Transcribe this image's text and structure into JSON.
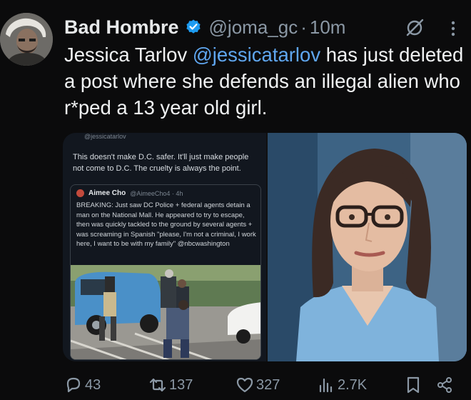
{
  "author": {
    "display_name": "Bad Hombre",
    "handle": "@joma_gc",
    "separator": "·",
    "time": "10m"
  },
  "tweet": {
    "text_before": "Jessica Tarlov ",
    "mention": "@jessicatarlov",
    "text_after": " has just deleted a post where she defends an illegal alien who r*ped a 13 year old girl."
  },
  "screenshot_left": {
    "handle": "@jessicatarlov",
    "text": "This doesn't make D.C. safer. It'll just make people not come to D.C. The cruelty is always the point.",
    "quote": {
      "name": "Aimee Cho",
      "handle_time": "@AimeeCho4 · 4h",
      "text": "BREAKING: Just saw DC Police + federal agents detain a man on the National Mall. He appeared to try to escape, then was quickly tackled to the ground by several agents + was screaming in Spanish \"please, I'm not a criminal, I work here, I want to be with my family\" @nbcwashington"
    }
  },
  "actions": {
    "replies": "43",
    "reposts": "137",
    "likes": "327",
    "views": "2.7K"
  },
  "icons": {
    "verified": "verified-badge-icon",
    "grok": "grok-icon",
    "more": "more-dots-icon",
    "reply": "reply-icon",
    "repost": "repost-icon",
    "like": "heart-icon",
    "views": "views-icon",
    "bookmark": "bookmark-icon",
    "share": "share-icon"
  },
  "colors": {
    "background": "#0b0b0c",
    "text": "#e7e9ea",
    "secondary": "#8b98a5",
    "mention": "#5fa6ef",
    "verified": "#1d9bf0"
  }
}
